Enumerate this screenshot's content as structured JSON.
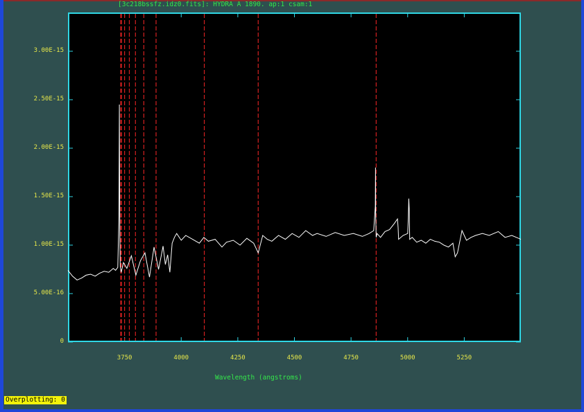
{
  "window": {
    "title": "[3c218bssfz.idz0.fits]: HYDRA A 1890. ap:1 csam:1"
  },
  "status_bar": {
    "text": "Overplotting: 0"
  },
  "colors": {
    "background": "#2f4f4f",
    "axes": "#2fd8e6",
    "labels": "#e8e84a",
    "title": "#34e84a",
    "spectrum": "#ffffff",
    "line_markers": "#d42020",
    "status_bg": "#f2f20a"
  },
  "chart_data": {
    "type": "line",
    "title": "[3c218bssfz.idz0.fits]: HYDRA A 1890. ap:1 csam:1",
    "xlabel": "Wavelength (angstroms)",
    "ylabel": "",
    "xlim": [
      3500,
      5500
    ],
    "ylim": [
      0,
      3.4e-15
    ],
    "x_ticks": [
      {
        "value": 3750,
        "label": "3750"
      },
      {
        "value": 4000,
        "label": "4000"
      },
      {
        "value": 4250,
        "label": "4250"
      },
      {
        "value": 4500,
        "label": "4500"
      },
      {
        "value": 4750,
        "label": "4750"
      },
      {
        "value": 5000,
        "label": "5000"
      },
      {
        "value": 5250,
        "label": "5250"
      }
    ],
    "y_ticks": [
      {
        "value": 0,
        "label": "0"
      },
      {
        "value": 5e-16,
        "label": "5.00E-16"
      },
      {
        "value": 1e-15,
        "label": "1.00E-15"
      },
      {
        "value": 1.5e-15,
        "label": "1.50E-15"
      },
      {
        "value": 2e-15,
        "label": "2.00E-15"
      },
      {
        "value": 2.5e-15,
        "label": "2.50E-15"
      },
      {
        "value": 3e-15,
        "label": "3.00E-15"
      }
    ],
    "grid": false,
    "line_markers_x": [
      3733,
      3736,
      3750,
      3771,
      3798,
      3835,
      3889,
      4102,
      4340,
      4861
    ],
    "series": [
      {
        "x": [
          3500,
          3520,
          3540,
          3560,
          3580,
          3600,
          3620,
          3640,
          3660,
          3680,
          3700,
          3710,
          3720,
          3725,
          3727,
          3729,
          3731,
          3735,
          3745,
          3760,
          3780,
          3800,
          3820,
          3840,
          3860,
          3880,
          3900,
          3910,
          3920,
          3930,
          3940,
          3950,
          3960,
          3970,
          3980,
          4000,
          4020,
          4050,
          4080,
          4100,
          4120,
          4150,
          4180,
          4200,
          4230,
          4260,
          4290,
          4320,
          4340,
          4360,
          4380,
          4400,
          4430,
          4460,
          4490,
          4520,
          4550,
          4580,
          4600,
          4640,
          4680,
          4720,
          4760,
          4800,
          4830,
          4850,
          4857,
          4858,
          4859,
          4861,
          4865,
          4880,
          4900,
          4920,
          4940,
          4955,
          4958,
          4960,
          4980,
          5000,
          5003,
          5005,
          5007,
          5009,
          5020,
          5040,
          5060,
          5080,
          5100,
          5120,
          5140,
          5160,
          5180,
          5200,
          5210,
          5220,
          5240,
          5260,
          5280,
          5300,
          5330,
          5360,
          5400,
          5430,
          5460,
          5490,
          5500
        ],
        "y": [
          7.4e-16,
          6.8e-16,
          6.4e-16,
          6.6e-16,
          6.9e-16,
          7e-16,
          6.8e-16,
          7.1e-16,
          7.3e-16,
          7.2e-16,
          7.6e-16,
          7.4e-16,
          7.7e-16,
          1.3e-15,
          2.45e-15,
          1.1e-15,
          7.8e-16,
          7.2e-16,
          8.2e-16,
          7.6e-16,
          8.9e-16,
          6.9e-16,
          8.4e-16,
          9.2e-16,
          6.7e-16,
          9.8e-16,
          7.5e-16,
          8.7e-16,
          9.9e-16,
          8e-16,
          9e-16,
          7.2e-16,
          1.02e-15,
          1.08e-15,
          1.12e-15,
          1.05e-15,
          1.1e-15,
          1.06e-15,
          1.02e-15,
          1.08e-15,
          1.04e-15,
          1.06e-15,
          9.8e-16,
          1.03e-15,
          1.05e-15,
          1e-15,
          1.07e-15,
          1.02e-15,
          9.2e-16,
          1.1e-15,
          1.06e-15,
          1.04e-15,
          1.1e-15,
          1.06e-15,
          1.12e-15,
          1.08e-15,
          1.15e-15,
          1.1e-15,
          1.12e-15,
          1.09e-15,
          1.13e-15,
          1.1e-15,
          1.12e-15,
          1.09e-15,
          1.12e-15,
          1.15e-15,
          1.4e-15,
          1.8e-15,
          1.3e-15,
          1.08e-15,
          1.12e-15,
          1.08e-15,
          1.14e-15,
          1.16e-15,
          1.22e-15,
          1.27e-15,
          1.18e-15,
          1.06e-15,
          1.1e-15,
          1.12e-15,
          1.28e-15,
          1.48e-15,
          1.38e-15,
          1.06e-15,
          1.08e-15,
          1.03e-15,
          1.05e-15,
          1.02e-15,
          1.06e-15,
          1.04e-15,
          1.03e-15,
          1e-15,
          9.8e-16,
          1.02e-15,
          8.8e-16,
          9.2e-16,
          1.15e-15,
          1.05e-15,
          1.08e-15,
          1.1e-15,
          1.12e-15,
          1.1e-15,
          1.14e-15,
          1.08e-15,
          1.1e-15,
          1.07e-15,
          1.06e-15
        ]
      }
    ]
  }
}
